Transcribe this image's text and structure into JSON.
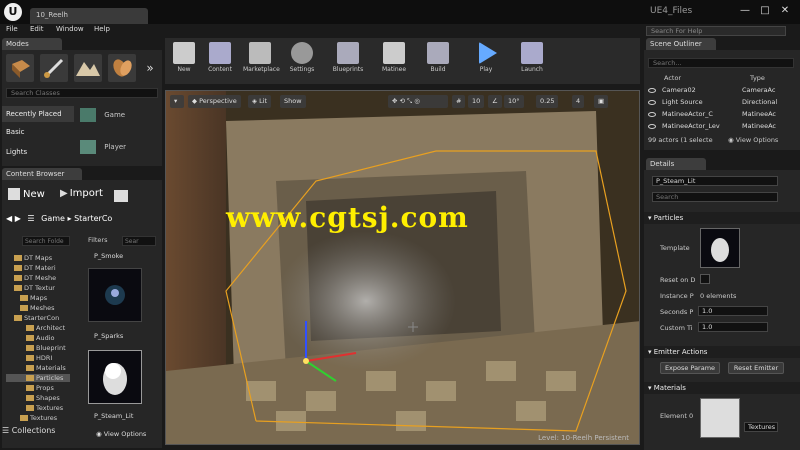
{
  "window": {
    "tab_title": "10_Reelh",
    "project_name": "UE4_Files",
    "minimize": "—",
    "maximize": "□",
    "close": "✕"
  },
  "menu": [
    "File",
    "Edit",
    "Window",
    "Help"
  ],
  "modes": {
    "tab_label": "Modes",
    "search_placeholder": "Search Classes",
    "categories": [
      "Recently Placed",
      "Basic",
      "Lights"
    ],
    "assets": [
      "Game",
      "Player"
    ]
  },
  "content_browser": {
    "tab_label": "Content Browser",
    "new_label": "New",
    "import_label": "Import",
    "path_root": "Game",
    "path_child": "StarterCo",
    "search_placeholder": "Search Folde",
    "filters_label": "Filters",
    "asset_search_placeholder": "Sear",
    "tree": [
      "DT Maps",
      "DT Materi",
      "DT Meshe",
      "DT Textur",
      "Maps",
      "Meshes",
      "StarterCon",
      "Architect",
      "Audio",
      "Blueprint",
      "HDRI",
      "Materials",
      "Particles",
      "Props",
      "Shapes",
      "Textures",
      "Textures"
    ],
    "assets": [
      "P_Smoke",
      "P_Sparks",
      "P_Steam_Lit"
    ],
    "collections_label": "Collections",
    "view_options_label": "View Options"
  },
  "toolbar": {
    "buttons": [
      "New",
      "Content",
      "Marketplace",
      "Settings",
      "Blueprints",
      "Matinee",
      "Build",
      "Play",
      "Launch"
    ]
  },
  "viewport": {
    "perspective_label": "Perspective",
    "lit_label": "Lit",
    "show_label": "Show",
    "grid_value": "10",
    "rot_value": "10°",
    "scale_value": "0.25",
    "cam_speed": "4",
    "watermark": "www.cgtsj.com",
    "level_label": "Level: 10-Reelh Persistent"
  },
  "search_help_placeholder": "Search For Help",
  "scene_outliner": {
    "tab_label": "Scene Outliner",
    "search_placeholder": "Search...",
    "col_actor": "Actor",
    "col_type": "Type",
    "rows": [
      {
        "name": "Camera02",
        "type": "CameraAc"
      },
      {
        "name": "Light Source",
        "type": "Directional"
      },
      {
        "name": "MatineeActor_C",
        "type": "MatineeAc"
      },
      {
        "name": "MatineeActor_Lev",
        "type": "MatineeAc"
      }
    ],
    "status": "99 actors (1 selecte",
    "view_options_label": "View Options"
  },
  "details": {
    "tab_label": "Details",
    "selected_name": "P_Steam_Lit",
    "search_placeholder": "Search",
    "particles_section": "Particles",
    "template_label": "Template",
    "reset_label": "Reset on D",
    "instance_label": "Instance P",
    "instance_value": "0 elements",
    "seconds_label": "Seconds P",
    "seconds_value": "1.0",
    "custom_label": "Custom Ti",
    "custom_value": "1.0",
    "emitter_section": "Emitter Actions",
    "expose_btn": "Expose Parame",
    "reset_btn": "Reset Emitter",
    "materials_section": "Materials",
    "element_label": "Element 0",
    "textures_label": "Textures"
  }
}
